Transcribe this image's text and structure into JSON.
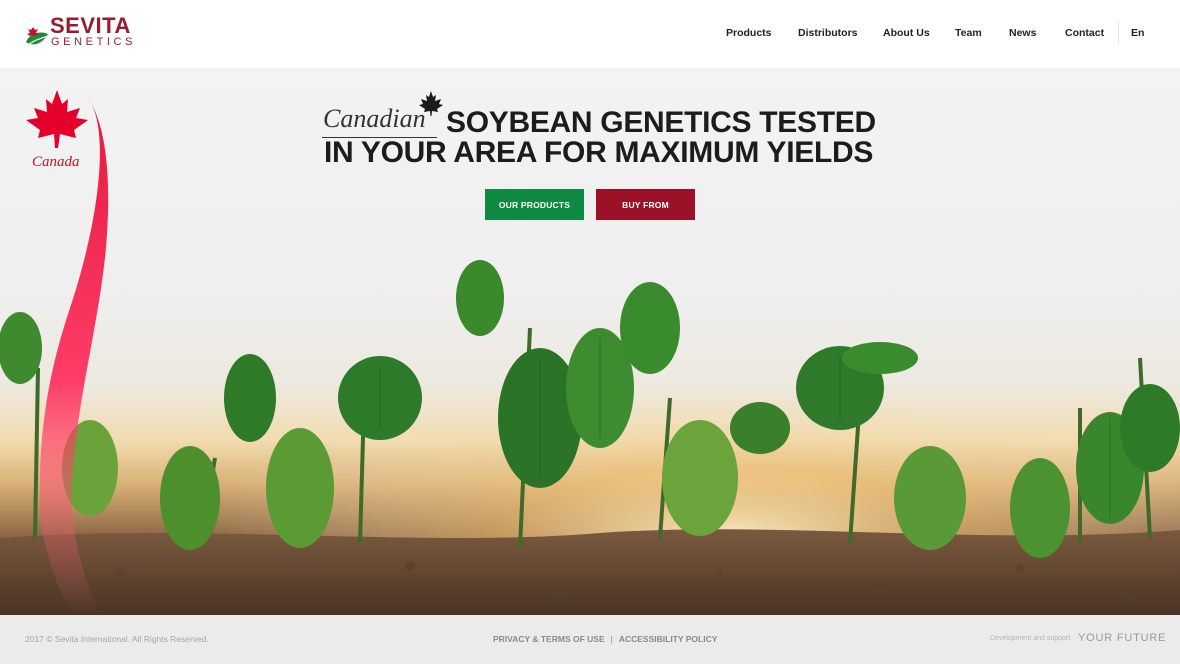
{
  "brand": {
    "logo_top": "SEVITA",
    "logo_bottom": "GENETICS",
    "colors": {
      "brand_red": "#9b1b2e",
      "green": "#0f8a42",
      "crimson": "#9b1228"
    }
  },
  "nav": {
    "items": [
      {
        "label": "Products"
      },
      {
        "label": "Distributors"
      },
      {
        "label": "About Us"
      },
      {
        "label": "Team"
      },
      {
        "label": "News"
      },
      {
        "label": "Contact"
      }
    ],
    "language": "En"
  },
  "hero": {
    "canadian": "Canadian",
    "headline_line1": "SOYBEAN GENETICS TESTED",
    "headline_line2": "IN YOUR AREA FOR MAXIMUM YIELDS",
    "primary_button": "OUR PRODUCTS",
    "secondary_button": "BUY FROM",
    "canada_badge": "Canada",
    "image": "soybean-seedlings-in-soil-at-sunset"
  },
  "footer": {
    "copyright": "2017 © Sevita International. All Rights Reserved.",
    "links": [
      "PRIVACY & TERMS OF USE",
      "ACCESSIBILITY POLICY"
    ],
    "separator": "|",
    "dev_text": "Development and support",
    "dev_brand": "YOUR FUTURE"
  }
}
